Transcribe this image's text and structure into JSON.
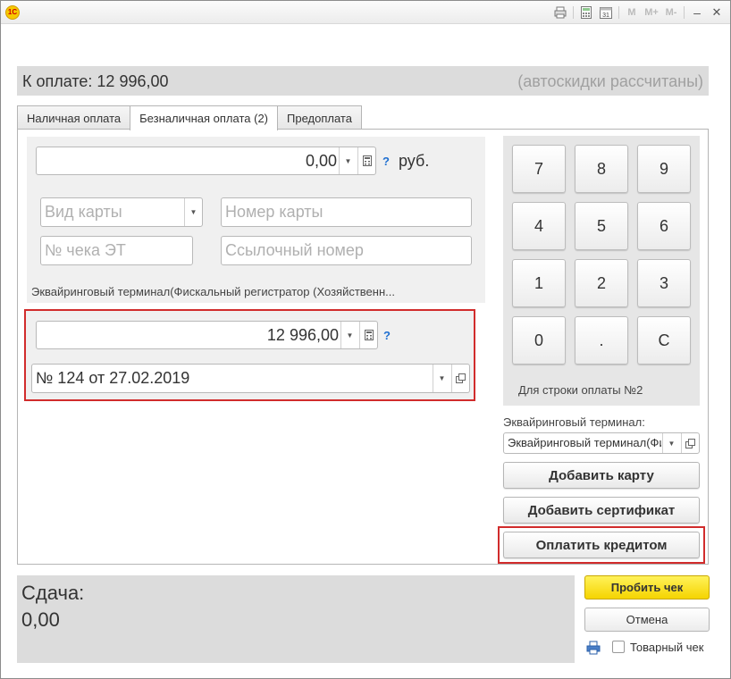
{
  "titlebar": {
    "logo": "1C",
    "icons": [
      "print-icon",
      "calculator-icon",
      "calendar-icon"
    ],
    "calendar_day": "31",
    "m_buttons": [
      "M",
      "M+",
      "M-"
    ],
    "minimize": "–",
    "close": "✕"
  },
  "header": {
    "amount": "К оплате: 12 996,00",
    "note": "(автоскидки рассчитаны)"
  },
  "tabs": [
    {
      "label": "Наличная оплата",
      "active": false
    },
    {
      "label": "Безналичная оплата (2)",
      "active": true
    },
    {
      "label": "Предоплата",
      "active": false
    }
  ],
  "card_section": {
    "amount_value": "0,00",
    "help": "?",
    "unit": "руб.",
    "card_type_placeholder": "Вид карты",
    "card_number_placeholder": "Номер карты",
    "receipt_number_placeholder": "№ чека ЭТ",
    "reference_number_placeholder": "Ссылочный номер",
    "terminal_label": "Эквайринговый терминал(Фискальный регистратор (Хозяйственн..."
  },
  "credit_section": {
    "amount_value": "12 996,00",
    "help": "?",
    "document_value": "№ 124 от 27.02.2019"
  },
  "keypad": {
    "keys": [
      "7",
      "8",
      "9",
      "4",
      "5",
      "6",
      "1",
      "2",
      "3",
      "0",
      ".",
      "C"
    ],
    "note": "Для строки оплаты №2"
  },
  "terminal": {
    "label": "Эквайринговый терминал:",
    "value": "Эквайринговый терминал(Фи"
  },
  "actions": {
    "add_card": "Добавить карту",
    "add_certificate": "Добавить сертификат",
    "pay_credit": "Оплатить кредитом"
  },
  "footer": {
    "change_label": "Сдача:",
    "change_value": "0,00",
    "print_receipt": "Пробить чек",
    "cancel": "Отмена",
    "goods_receipt": "Товарный чек"
  }
}
